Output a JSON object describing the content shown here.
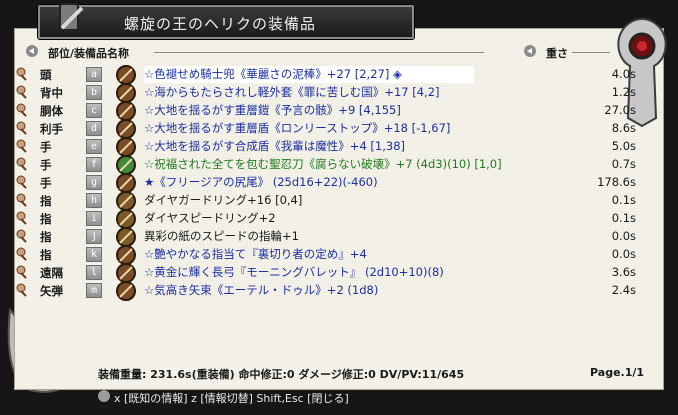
{
  "window": {
    "title": "螺旋の王のヘリクの装備品"
  },
  "header": {
    "left_label": "部位/装備品名称",
    "right_label": "重さ"
  },
  "rows": [
    {
      "slot": "頭",
      "key": "a",
      "icon": "helmet-icon",
      "text": "☆色褪せめ騎士兜《華麗さの泥棒》+27 [2,27] ◈",
      "weight": "4.0s",
      "color": "blue"
    },
    {
      "slot": "背中",
      "key": "b",
      "icon": "cloak-icon",
      "text": "☆海からもたらされし軽外套《罪に苦しむ国》+17 [4,2]",
      "weight": "1.2s",
      "color": "blue"
    },
    {
      "slot": "胴体",
      "key": "c",
      "icon": "armor-icon",
      "text": "☆大地を揺るがす重層鎧《予言の骸》+9 [4,155]",
      "weight": "27.0s",
      "color": "blue"
    },
    {
      "slot": "利手",
      "key": "d",
      "icon": "shield-icon",
      "text": "☆大地を揺るがす重層盾《ロンリーストップ》+18 [-1,67]",
      "weight": "8.6s",
      "color": "blue"
    },
    {
      "slot": "手",
      "key": "e",
      "icon": "shield2-icon",
      "text": "☆大地を揺るがす合成盾《我輩は魔性》+4 [1,38]",
      "weight": "5.0s",
      "color": "blue"
    },
    {
      "slot": "手",
      "key": "f",
      "icon": "sword-icon",
      "text": "☆祝福された全てを包む聖忍刀《腐らない破壊》+7 (4d3)(10) [1,0]",
      "weight": "0.7s",
      "color": "green"
    },
    {
      "slot": "手",
      "key": "g",
      "icon": "staff-icon",
      "text": "★《フリージアの尻尾》 (25d16+22)(-460)",
      "weight": "178.6s",
      "color": "blue"
    },
    {
      "slot": "指",
      "key": "h",
      "icon": "ring-icon",
      "text": "ダイヤガードリング+16 [0,4]",
      "weight": "0.1s",
      "color": "black"
    },
    {
      "slot": "指",
      "key": "i",
      "icon": "ring2-icon",
      "text": "ダイヤスピードリング+2",
      "weight": "0.1s",
      "color": "black"
    },
    {
      "slot": "指",
      "key": "j",
      "icon": "ring3-icon",
      "text": "異彩の紙のスピードの指輪+1",
      "weight": "0.0s",
      "color": "black"
    },
    {
      "slot": "指",
      "key": "k",
      "icon": "ring4-icon",
      "text": "☆艶やかなる指当て『裏切り者の定め』+4",
      "weight": "0.0s",
      "color": "blue"
    },
    {
      "slot": "遠隔",
      "key": "l",
      "icon": "bow-icon",
      "text": "☆黄金に輝く長弓『モーニングバレット』 (2d10+10)(8)",
      "weight": "3.6s",
      "color": "blue"
    },
    {
      "slot": "矢弾",
      "key": "m",
      "icon": "arrow-icon",
      "text": "☆気高き矢束《エーテル・ドゥル》+2 (1d8)",
      "weight": "2.4s",
      "color": "blue"
    }
  ],
  "footer": {
    "summary": "装備重量: 231.6s(重装備) 命中修正:0 ダメージ修正:0 DV/PV:11/645",
    "page": "Page.1/1",
    "hint": "x [既知の情報] z [情報切替] Shift,Esc [閉じる]"
  },
  "colors": {
    "blue": "#1a2fa6",
    "green": "#1f7a1f",
    "black": "#1a1a1a",
    "panel": "#f4f2e8"
  }
}
